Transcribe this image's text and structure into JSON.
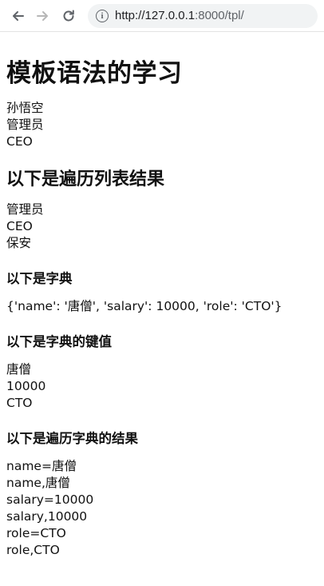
{
  "browser": {
    "url_host": "http://127.0.0.1",
    "url_rest": ":8000/tpl/"
  },
  "page": {
    "title": "模板语法的学习",
    "intro_lines": [
      "孙悟空",
      "管理员",
      "CEO"
    ],
    "list_heading": "以下是遍历列表结果",
    "list_items": [
      "管理员",
      "CEO",
      "保安"
    ],
    "dict_heading": "以下是字典",
    "dict_repr": "{'name': '唐僧', 'salary': 10000, 'role': 'CTO'}",
    "dict_values_heading": "以下是字典的键值",
    "dict_values": [
      "唐僧",
      "10000",
      "CTO"
    ],
    "dict_loop_heading": "以下是遍历字典的结果",
    "dict_loop_lines": [
      "name=唐僧",
      "name,唐僧",
      "salary=10000",
      "salary,10000",
      "role=CTO",
      "role,CTO"
    ]
  }
}
